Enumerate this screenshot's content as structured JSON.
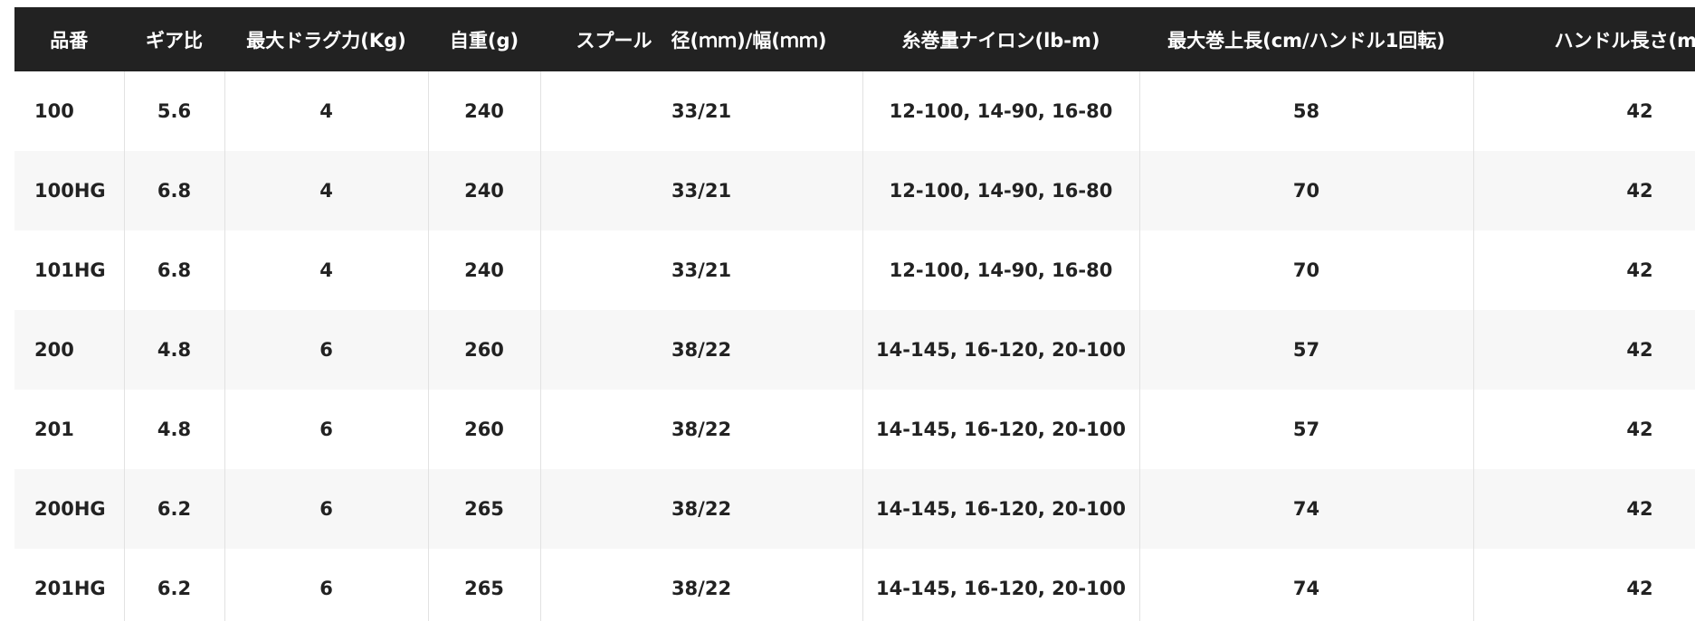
{
  "table": {
    "headers": [
      "品番",
      "ギア比",
      "最大ドラグ力(Kg)",
      "自重(g)",
      "スプール　径(ｍｍ)/幅(ｍｍ)",
      "糸巻量ナイロン(lb-m)",
      "最大巻上長(cm/ハンドル1回転)",
      "ハンドル長さ(mm)"
    ],
    "rows": [
      [
        "100",
        "5.6",
        "4",
        "240",
        "33/21",
        "12-100, 14-90, 16-80",
        "58",
        "42"
      ],
      [
        "100HG",
        "6.8",
        "4",
        "240",
        "33/21",
        "12-100, 14-90, 16-80",
        "70",
        "42"
      ],
      [
        "101HG",
        "6.8",
        "4",
        "240",
        "33/21",
        "12-100, 14-90, 16-80",
        "70",
        "42"
      ],
      [
        "200",
        "4.8",
        "6",
        "260",
        "38/22",
        "14-145, 16-120, 20-100",
        "57",
        "42"
      ],
      [
        "201",
        "4.8",
        "6",
        "260",
        "38/22",
        "14-145, 16-120, 20-100",
        "57",
        "42"
      ],
      [
        "200HG",
        "6.2",
        "6",
        "265",
        "38/22",
        "14-145, 16-120, 20-100",
        "74",
        "42"
      ],
      [
        "201HG",
        "6.2",
        "6",
        "265",
        "38/22",
        "14-145, 16-120, 20-100",
        "74",
        "42"
      ]
    ]
  },
  "colors": {
    "header_bg": "#222222",
    "header_text": "#ffffff",
    "row_alt_bg": "#f7f7f7",
    "cell_text": "#222222",
    "divider": "#e2e2e2"
  }
}
